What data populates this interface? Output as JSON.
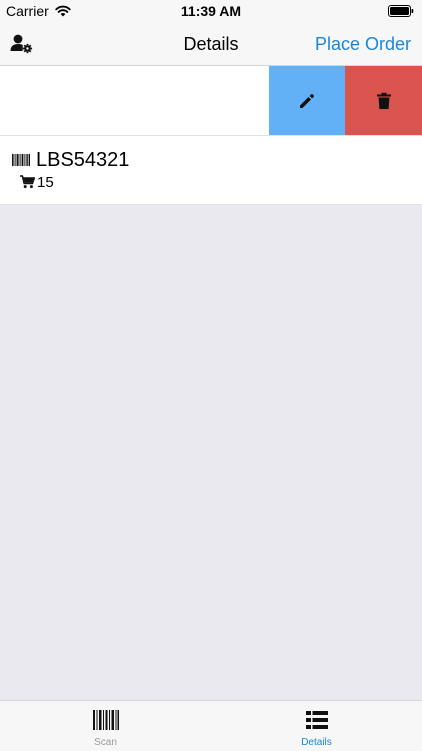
{
  "status_bar": {
    "carrier": "Carrier",
    "time": "11:39 AM",
    "wifi_icon": "wifi-icon",
    "battery_icon": "battery-icon"
  },
  "nav": {
    "title": "Details",
    "action": "Place Order",
    "left_icon": "user-settings-icon",
    "colors": {
      "accent": "#1b86d9"
    }
  },
  "swipe_row": {
    "actions": [
      {
        "icon": "pencil-icon",
        "color": "#62b1f6"
      },
      {
        "icon": "trash-icon",
        "color": "#d9534f"
      }
    ]
  },
  "items": [
    {
      "code": "LBS54321",
      "quantity": "15",
      "code_icon": "barcode-icon",
      "qty_icon": "cart-icon"
    }
  ],
  "tabs": [
    {
      "label": "Scan",
      "icon": "barcode-icon",
      "selected": false
    },
    {
      "label": "Details",
      "icon": "list-icon",
      "selected": true
    }
  ]
}
